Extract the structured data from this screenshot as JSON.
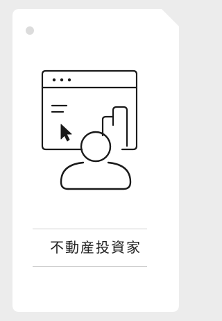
{
  "card": {
    "label": "不動産投資家",
    "icon": "browser-window-with-cursor-and-person-icon"
  },
  "colors": {
    "background": "#ececec",
    "card": "#ffffff",
    "stroke": "#1a1a1a",
    "divider": "#cfcfcf",
    "text": "#222222"
  }
}
